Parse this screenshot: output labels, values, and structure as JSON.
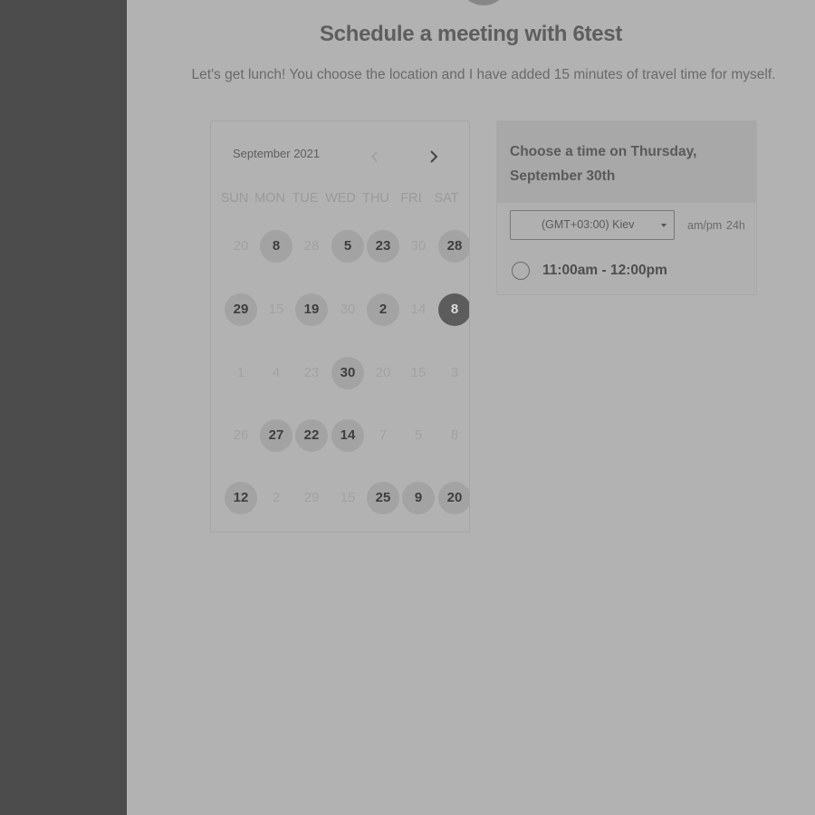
{
  "meeting": {
    "title": "Schedule a meeting with 6test",
    "description": "Let's get lunch! You choose the location and I have added 15 minutes of travel time for myself."
  },
  "calendar": {
    "month_label": "September 2021",
    "prev_icon": "chevron-left-icon",
    "next_icon": "chevron-right-icon",
    "weekdays": [
      "SUN",
      "MON",
      "TUE",
      "WED",
      "THU",
      "FRI",
      "SAT"
    ],
    "weeks": [
      [
        {
          "text": "20",
          "state": "disabled"
        },
        {
          "text": "8",
          "state": "available"
        },
        {
          "text": "28",
          "state": "disabled"
        },
        {
          "text": "5",
          "state": "available"
        },
        {
          "text": "23",
          "state": "available"
        },
        {
          "text": "30",
          "state": "disabled"
        },
        {
          "text": "28",
          "state": "available"
        }
      ],
      [
        {
          "text": "29",
          "state": "available"
        },
        {
          "text": "15",
          "state": "disabled"
        },
        {
          "text": "19",
          "state": "available"
        },
        {
          "text": "30",
          "state": "disabled"
        },
        {
          "text": "2",
          "state": "available"
        },
        {
          "text": "14",
          "state": "disabled"
        },
        {
          "text": "8",
          "state": "selected"
        }
      ],
      [
        {
          "text": "1",
          "state": "disabled"
        },
        {
          "text": "4",
          "state": "disabled"
        },
        {
          "text": "23",
          "state": "disabled"
        },
        {
          "text": "30",
          "state": "available"
        },
        {
          "text": "20",
          "state": "disabled"
        },
        {
          "text": "15",
          "state": "disabled"
        },
        {
          "text": "3",
          "state": "disabled"
        }
      ],
      [
        {
          "text": "26",
          "state": "disabled"
        },
        {
          "text": "27",
          "state": "available"
        },
        {
          "text": "22",
          "state": "available"
        },
        {
          "text": "14",
          "state": "available"
        },
        {
          "text": "7",
          "state": "disabled"
        },
        {
          "text": "5",
          "state": "disabled"
        },
        {
          "text": "8",
          "state": "disabled"
        }
      ],
      [
        {
          "text": "12",
          "state": "available"
        },
        {
          "text": "2",
          "state": "disabled"
        },
        {
          "text": "29",
          "state": "disabled"
        },
        {
          "text": "15",
          "state": "disabled"
        },
        {
          "text": "25",
          "state": "available"
        },
        {
          "text": "9",
          "state": "available"
        },
        {
          "text": "20",
          "state": "available"
        }
      ]
    ]
  },
  "time_panel": {
    "heading": "Choose a time on Thursday, September 30th",
    "timezone": "(GMT+03:00) Kiev",
    "format_12h": "am/pm",
    "format_24h": "24h",
    "slots": [
      "11:00am - 12:00pm"
    ]
  }
}
